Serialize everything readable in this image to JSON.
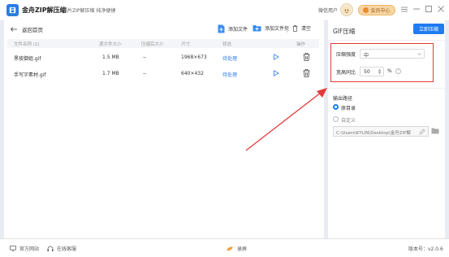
{
  "titlebar": {
    "app_name": "金舟ZIP解压缩",
    "subtitle": "图片ZIP解压缩 纯净便捷",
    "user_name": "微信用户",
    "vip_label": "会员中心",
    "menu_icon": "menu-icon",
    "minimize_icon": "minimize-icon",
    "maximize_icon": "maximize-icon",
    "close_icon": "close-icon"
  },
  "toolbar": {
    "back_label": "返回首页",
    "add_file_label": "添加文件",
    "add_folder_label": "添加文件夹",
    "clear_label": "清空"
  },
  "table": {
    "headers": [
      "文件名称 (2)",
      "源文件大小",
      "压缩后大小",
      "尺寸",
      "状态",
      "操作"
    ],
    "rows": [
      {
        "name": "黑夜御姐.gif",
        "size": "1.5 MB",
        "compressed": "--",
        "dimensions": "1968×673",
        "status": "待处理"
      },
      {
        "name": "手写字素材.gif",
        "size": "1.7 MB",
        "compressed": "--",
        "dimensions": "640×432",
        "status": "待处理"
      }
    ]
  },
  "right_panel": {
    "title": "GIF压缩",
    "compress_button": "立即压缩",
    "strength_label": "压缩强度",
    "strength_value": "中",
    "ratio_label": "宽高同比",
    "ratio_value": "50",
    "ratio_unit": "%",
    "output_label": "输出路径",
    "option_source": "原目录",
    "option_custom": "自定义",
    "output_path": "C:\\Users\\KYLIN\\Desktop\\金舟ZIP解"
  },
  "statusbar": {
    "website": "官方网站",
    "support": "在线客服",
    "record": "录屏",
    "version": "版本号：v2.0.6"
  },
  "colors": {
    "accent": "#1e7cf0",
    "highlight": "#e23b3b",
    "status_pending": "#2c7be5"
  }
}
